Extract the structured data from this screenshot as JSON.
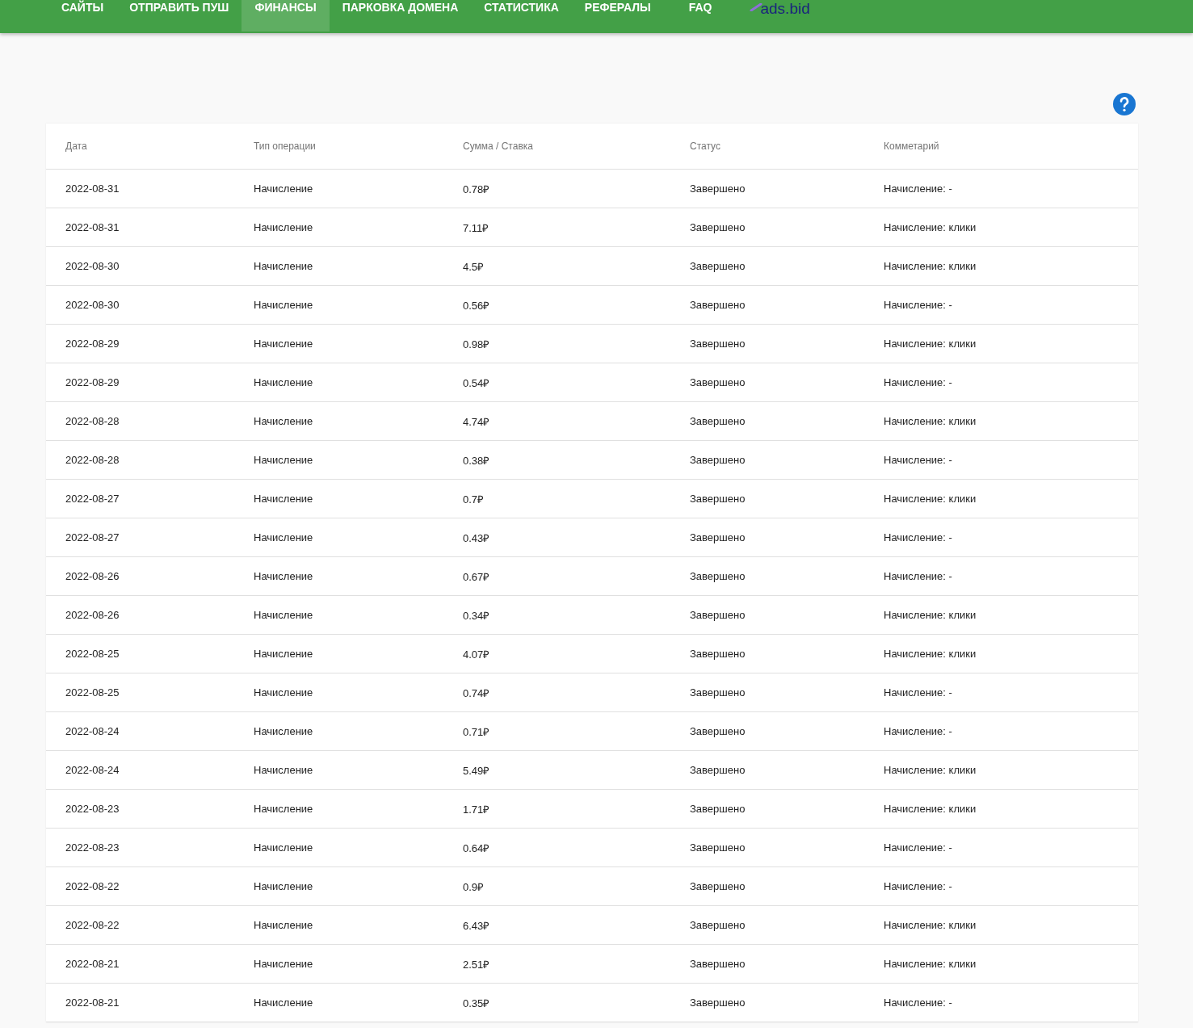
{
  "nav": {
    "items": [
      {
        "label": "САЙТЫ",
        "selected": false
      },
      {
        "label": "ОТПРАВИТЬ ПУШ",
        "selected": false
      },
      {
        "label": "ФИНАНСЫ",
        "selected": true
      },
      {
        "label": "ПАРКОВКА ДОМЕНА",
        "selected": false
      },
      {
        "label": "СТАТИСТИКА",
        "selected": false
      },
      {
        "label": "РЕФЕРАЛЫ",
        "selected": false
      },
      {
        "label": "FAQ",
        "selected": false
      }
    ],
    "logo": "ads.bid"
  },
  "table": {
    "columns": [
      "Дата",
      "Тип операции",
      "Сумма / Ставка",
      "Статус",
      "Комметарий"
    ],
    "rows": [
      [
        "2022-08-31",
        "Начисление",
        "0.78₽",
        "Завершено",
        "Начисление: -"
      ],
      [
        "2022-08-31",
        "Начисление",
        "7.11₽",
        "Завершено",
        "Начисление: клики"
      ],
      [
        "2022-08-30",
        "Начисление",
        "4.5₽",
        "Завершено",
        "Начисление: клики"
      ],
      [
        "2022-08-30",
        "Начисление",
        "0.56₽",
        "Завершено",
        "Начисление: -"
      ],
      [
        "2022-08-29",
        "Начисление",
        "0.98₽",
        "Завершено",
        "Начисление: клики"
      ],
      [
        "2022-08-29",
        "Начисление",
        "0.54₽",
        "Завершено",
        "Начисление: -"
      ],
      [
        "2022-08-28",
        "Начисление",
        "4.74₽",
        "Завершено",
        "Начисление: клики"
      ],
      [
        "2022-08-28",
        "Начисление",
        "0.38₽",
        "Завершено",
        "Начисление: -"
      ],
      [
        "2022-08-27",
        "Начисление",
        "0.7₽",
        "Завершено",
        "Начисление: клики"
      ],
      [
        "2022-08-27",
        "Начисление",
        "0.43₽",
        "Завершено",
        "Начисление: -"
      ],
      [
        "2022-08-26",
        "Начисление",
        "0.67₽",
        "Завершено",
        "Начисление: -"
      ],
      [
        "2022-08-26",
        "Начисление",
        "0.34₽",
        "Завершено",
        "Начисление: клики"
      ],
      [
        "2022-08-25",
        "Начисление",
        "4.07₽",
        "Завершено",
        "Начисление: клики"
      ],
      [
        "2022-08-25",
        "Начисление",
        "0.74₽",
        "Завершено",
        "Начисление: -"
      ],
      [
        "2022-08-24",
        "Начисление",
        "0.71₽",
        "Завершено",
        "Начисление: -"
      ],
      [
        "2022-08-24",
        "Начисление",
        "5.49₽",
        "Завершено",
        "Начисление: клики"
      ],
      [
        "2022-08-23",
        "Начисление",
        "1.71₽",
        "Завершено",
        "Начисление: клики"
      ],
      [
        "2022-08-23",
        "Начисление",
        "0.64₽",
        "Завершено",
        "Начисление: -"
      ],
      [
        "2022-08-22",
        "Начисление",
        "0.9₽",
        "Завершено",
        "Начисление: -"
      ],
      [
        "2022-08-22",
        "Начисление",
        "6.43₽",
        "Завершено",
        "Начисление: клики"
      ],
      [
        "2022-08-21",
        "Начисление",
        "2.51₽",
        "Завершено",
        "Начисление: клики"
      ],
      [
        "2022-08-21",
        "Начисление",
        "0.35₽",
        "Завершено",
        "Начисление: -"
      ]
    ]
  }
}
